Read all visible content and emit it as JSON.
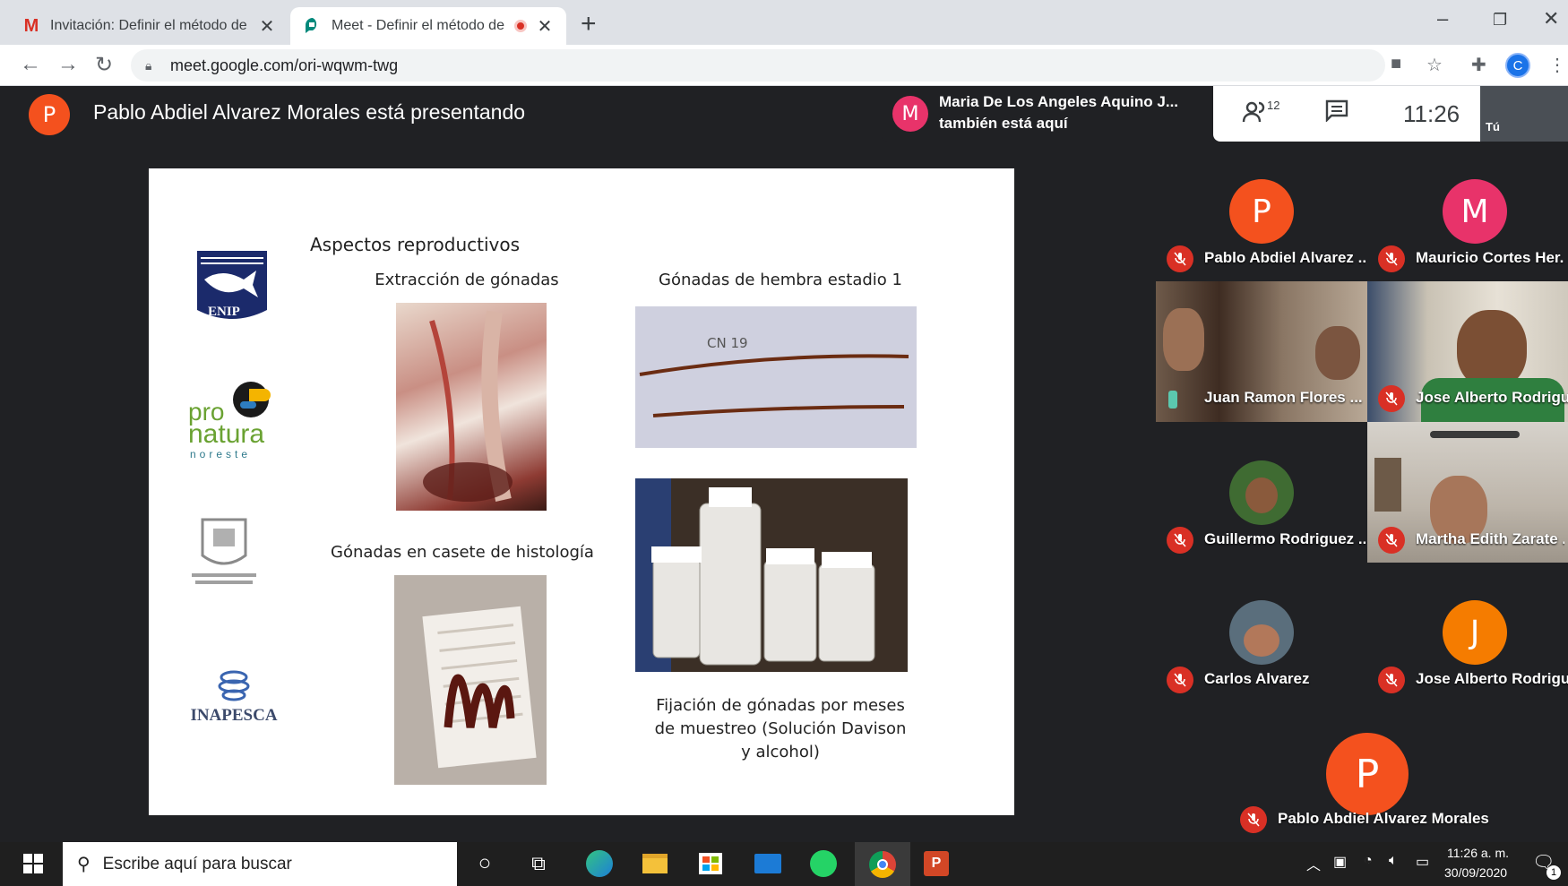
{
  "browser": {
    "tabs": [
      {
        "title": "Invitación: Definir el método de",
        "close": "✕"
      },
      {
        "title": "Meet - Definir el método de",
        "close": "✕"
      }
    ],
    "new_tab": "+",
    "url": "meet.google.com/ori-wqwm-twg",
    "profile_initial": "C"
  },
  "meet": {
    "presenter_initial": "P",
    "presenter_text": "Pablo Abdiel Alvarez Morales está presentando",
    "notification": {
      "initial": "M",
      "line1": "Maria De Los Angeles Aquino J...",
      "line2": "también está aquí"
    },
    "people_count": "12",
    "time": "11:26",
    "self_label": "Tú",
    "participants": [
      {
        "name": "Pablo Abdiel Alvarez ...",
        "initial": "P",
        "color": "#f4511e"
      },
      {
        "name": "Mauricio Cortes Her...",
        "initial": "M",
        "color": "#e8336a"
      },
      {
        "name": "Juan Ramon Flores ..."
      },
      {
        "name": "Jose Alberto Rodrigu..."
      },
      {
        "name": "Guillermo Rodriguez ..."
      },
      {
        "name": "Martha Edith Zarate ..."
      },
      {
        "name": "Carlos Alvarez"
      },
      {
        "name": "Jose Alberto Rodrigu...",
        "initial": "J",
        "color": "#f57c00"
      },
      {
        "name": "Pablo Abdiel Alvarez Morales",
        "initial": "P",
        "color": "#f4511e"
      }
    ]
  },
  "slide": {
    "title": "Aspectos reproductivos",
    "cap1": "Extracción de gónadas",
    "cap2": "Gónadas de hembra estadio 1",
    "cap3": "Gónadas en casete de histología",
    "cap4_l1": "Fijación de gónadas por meses",
    "cap4_l2": "de muestreo  (Solución Davison",
    "cap4_l3": "y alcohol)",
    "logo_enip": "ENIP",
    "logo_pro": "pro",
    "logo_natura": "natura",
    "logo_noreste": "noreste",
    "logo_inapesca": "INAPESCA",
    "photo2_mark": "CN 19"
  },
  "taskbar": {
    "search_placeholder": "Escribe aquí para buscar",
    "time": "11:26 a. m.",
    "date": "30/09/2020",
    "notif_count": "1"
  }
}
